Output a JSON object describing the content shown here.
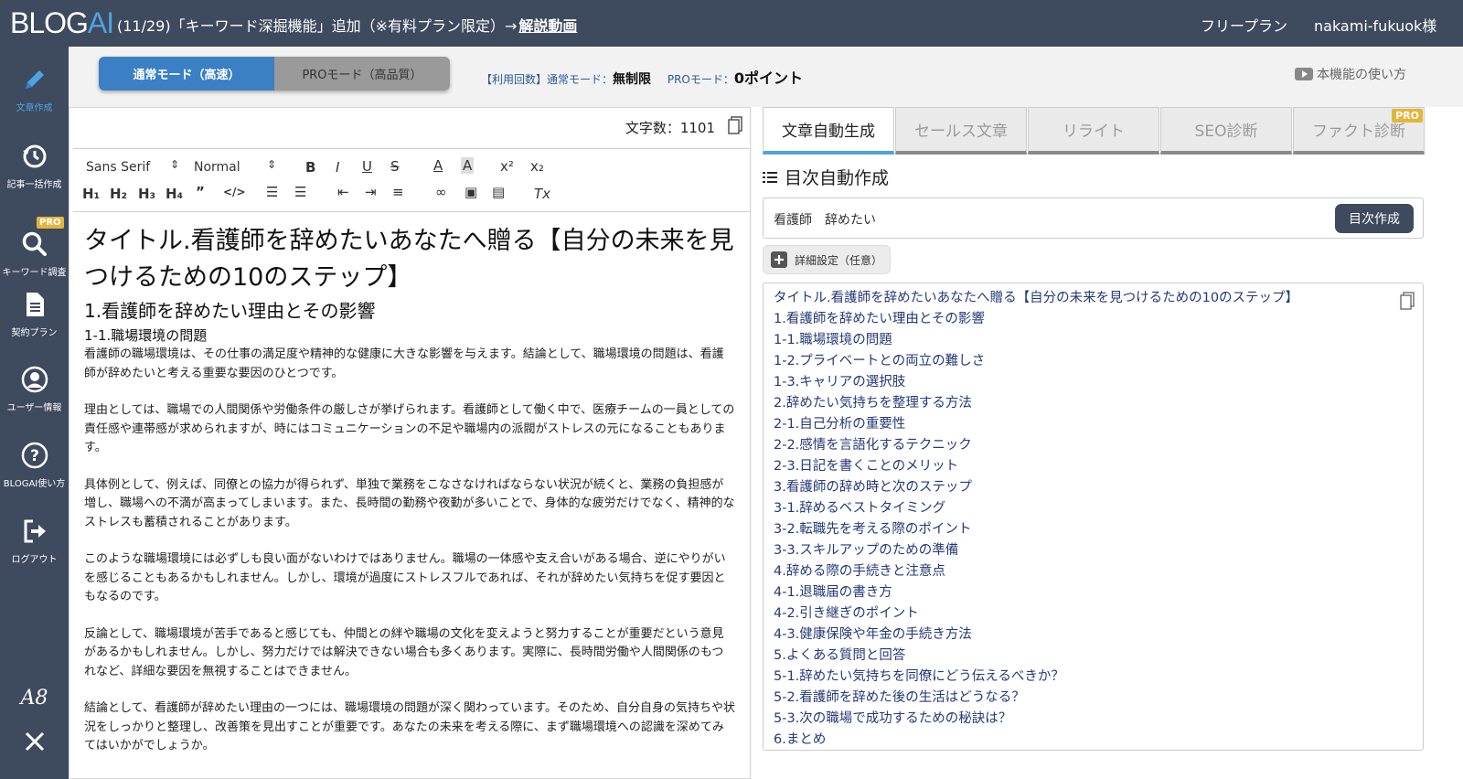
{
  "header": {
    "logo_main": "BLOG",
    "logo_ai": "AI",
    "announcement": "(11/29)「キーワード深掘機能」追加（※有料プラン限定）→",
    "announcement_link": "解説動画",
    "plan": "フリープラン",
    "user": "nakami-fukuok様"
  },
  "sidebar": {
    "items": [
      {
        "label": "文章作成",
        "icon": "pencil-icon"
      },
      {
        "label": "記事一括作成",
        "icon": "history-icon"
      },
      {
        "label": "キーワード調査",
        "icon": "search-icon",
        "badge": "PRO"
      },
      {
        "label": "契約プラン",
        "icon": "document-icon"
      },
      {
        "label": "ユーザー情報",
        "icon": "user-icon"
      },
      {
        "label": "BLOGAI使い方",
        "icon": "question-icon"
      },
      {
        "label": "ログアウト",
        "icon": "logout-icon"
      }
    ],
    "a8": "A8",
    "x": "X"
  },
  "modes": {
    "normal": "通常モード（高速）",
    "pro": "PROモード（高品質）"
  },
  "usage": {
    "prefix": "【利用回数】通常モード：",
    "normal_value": "無制限",
    "pro_label": "PROモード：",
    "pro_value": "0ポイント"
  },
  "howto": "本機能の使い方",
  "editor": {
    "char_count": "文字数：1101",
    "font": "Sans Serif",
    "size": "Normal",
    "title": "タイトル.看護師を辞めたいあなたへ贈る【自分の未来を見つけるための10のステップ】",
    "h2": "1.看護師を辞めたい理由とその影響",
    "h3": "1-1.職場環境の問題",
    "paragraphs": [
      "看護師の職場環境は、その仕事の満足度や精神的な健康に大きな影響を与えます。結論として、職場環境の問題は、看護師が辞めたいと考える重要な要因のひとつです。",
      "理由としては、職場での人間関係や労働条件の厳しさが挙げられます。看護師として働く中で、医療チームの一員としての責任感や連帯感が求められますが、時にはコミュニケーションの不足や職場内の派閥がストレスの元になることもあります。",
      "具体例として、例えば、同僚との協力が得られず、単独で業務をこなさなければならない状況が続くと、業務の負担感が増し、職場への不満が高まってしまいます。また、長時間の勤務や夜勤が多いことで、身体的な疲労だけでなく、精神的なストレスも蓄積されることがあります。",
      "このような職場環境には必ずしも良い面がないわけではありません。職場の一体感や支え合いがある場合、逆にやりがいを感じることもあるかもしれません。しかし、環境が過度にストレスフルであれば、それが辞めたい気持ちを促す要因ともなるのです。",
      "反論として、職場環境が苦手であると感じても、仲間との絆や職場の文化を変えようと努力することが重要だという意見があるかもしれません。しかし、努力だけでは解決できない場合も多くあります。実際に、長時間労働や人間関係のもつれなど、詳細な要因を無視することはできません。",
      "結論として、看護師が辞めたい理由の一つには、職場環境の問題が深く関わっています。そのため、自分自身の気持ちや状況をしっかりと整理し、改善策を見出すことが重要です。あなたの未来を考える際に、まず職場環境への認識を深めてみてはいかがでしょうか。"
    ]
  },
  "right": {
    "tabs": [
      {
        "label": "文章自動生成",
        "active": true
      },
      {
        "label": "セールス文章"
      },
      {
        "label": "リライト"
      },
      {
        "label": "SEO診断"
      },
      {
        "label": "ファクト診断",
        "badge": "PRO"
      }
    ],
    "section_title": "目次自動作成",
    "keyword": "看護師　辞めたい",
    "create_button": "目次作成",
    "detail_button": "詳細設定（任意）",
    "toc": [
      "タイトル.看護師を辞めたいあなたへ贈る【自分の未来を見つけるための10のステップ】",
      "1.看護師を辞めたい理由とその影響",
      "1-1.職場環境の問題",
      "1-2.プライベートとの両立の難しさ",
      "1-3.キャリアの選択肢",
      "2.辞めたい気持ちを整理する方法",
      "2-1.自己分析の重要性",
      "2-2.感情を言語化するテクニック",
      "2-3.日記を書くことのメリット",
      "3.看護師の辞め時と次のステップ",
      "3-1.辞めるベストタイミング",
      "3-2.転職先を考える際のポイント",
      "3-3.スキルアップのための準備",
      "4.辞める際の手続きと注意点",
      "4-1.退職届の書き方",
      "4-2.引き継ぎのポイント",
      "4-3.健康保険や年金の手続き方法",
      "5.よくある質問と回答",
      "5-1.辞めたい気持ちを同僚にどう伝えるべきか？",
      "5-2.看護師を辞めた後の生活はどうなる？",
      "5-3.次の職場で成功するための秘訣は？",
      "6.まとめ"
    ]
  }
}
